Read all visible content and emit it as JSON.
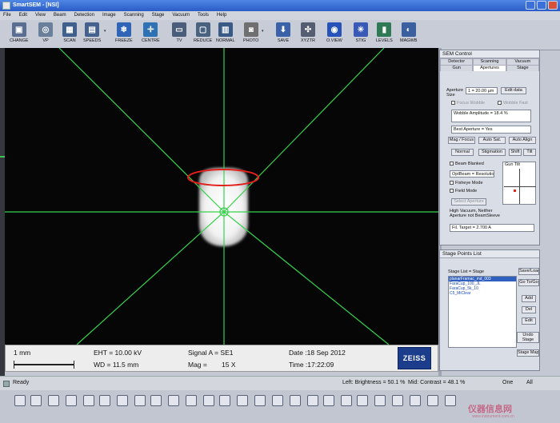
{
  "window": {
    "title": "SmartSEM - [NSI]"
  },
  "menu": [
    "File",
    "Edit",
    "View",
    "Beam",
    "Detection",
    "Image",
    "Scanning",
    "Stage",
    "Vacuum",
    "Tools",
    "Help"
  ],
  "toolbar": [
    {
      "label": "CHANGE",
      "icon": "change-icon",
      "color": "#5a6e92"
    },
    {
      "label": "VP",
      "icon": "vp-icon",
      "color": "#6a7f99"
    },
    {
      "label": "SCAN",
      "icon": "scan-icon",
      "color": "#3f5f8d"
    },
    {
      "label": "SPEEDS",
      "icon": "speeds-icon",
      "color": "#46618e"
    },
    {
      "label": "FREEZE",
      "icon": "freeze-icon",
      "color": "#2f64b6"
    },
    {
      "label": "CENTRE",
      "icon": "centre-icon",
      "color": "#2f72b4"
    },
    {
      "label": "TV",
      "icon": "tv-icon",
      "color": "#4a5e7c"
    },
    {
      "label": "REDUCE",
      "icon": "reduce-icon",
      "color": "#48627f"
    },
    {
      "label": "NORMAL",
      "icon": "normal-icon",
      "color": "#3a5a86"
    },
    {
      "label": "PHOTO",
      "icon": "photo-icon",
      "color": "#6f6f6f"
    },
    {
      "label": "SAVE",
      "icon": "save-icon",
      "color": "#3b62a8"
    },
    {
      "label": "XYZTR",
      "icon": "xyztr-icon",
      "color": "#555d70"
    },
    {
      "label": "O.VIEW",
      "icon": "oview-icon",
      "color": "#2753b8"
    },
    {
      "label": "STIG",
      "icon": "stig-icon",
      "color": "#3959b6"
    },
    {
      "label": "LEVELS",
      "icon": "levels-icon",
      "color": "#2d7a55"
    },
    {
      "label": "MAGWB",
      "icon": "magwb-icon",
      "color": "#3b5f9f"
    }
  ],
  "info": {
    "scale_label": "1 mm",
    "eht": "EHT = 10.00 kV",
    "wd": "WD = 11.5 mm",
    "signal": "Signal A = SE1",
    "mag_label": "Mag =",
    "mag_value": "15 X",
    "date": "Date :18 Sep 2012",
    "time": "Time :17:22:09",
    "logo": "ZEISS"
  },
  "sem": {
    "title": "SEM Control",
    "tabs_top": [
      "Detector",
      "Scanning",
      "Vacuum"
    ],
    "tabs_bottom": [
      "Gun",
      "Apertures",
      "Stage"
    ],
    "aperture_label": "Aperture Size",
    "aperture_value": "1 = 20.00 µm",
    "edit_data": "Edit data",
    "focus_wobble": "Focus Wobble",
    "wobble_fast": "Wobble Fast",
    "wobble_amplitude": "Wobble Amplitude = 18.4 %",
    "best_aperture": "Best Aperture = Yes",
    "mag_focus": "Mag / Focus",
    "auto_sat": "Auto Sat.",
    "auto_align": "Auto Align",
    "normal": "Normal",
    "stigmation": "Stigmation",
    "shift": "Shift",
    "tilt": "Tilt",
    "beam_blanked": "Beam Blanked",
    "optbeam": "OptBeam = Resolution",
    "gun_tilt": "Gun Tilt",
    "fisheye": "Fisheye Mode",
    "field": "Field Mode",
    "select_aperture": "Select Aperture",
    "status": "High Vacuum, Neither Aperture not BeamSleeve",
    "fil_target": "Fil. Target = 2.700 A"
  },
  "stage_points": {
    "title": "Stage Points List",
    "list_label": "Stage List = Stage",
    "items": [
      "planarFramac_md_003",
      "FaraCup_100_JL",
      "FaraCup_5k_10",
      "C5_MiClear"
    ],
    "buttons": [
      "Save/Load",
      "Go To/Go",
      "Add",
      "Del",
      "Edit",
      "Undo Stage Goto",
      "Stage Map"
    ]
  },
  "status": {
    "ready": "Ready",
    "brightness": "Left: Brightness = 50.1 %",
    "mid": "Mid: Contrast = 48.1 %",
    "one": "One",
    "all": "All"
  },
  "watermark": "仪器信息网",
  "watermark_url": "www.instrument.com.cn",
  "colors": {
    "crosshair": "#37d24e",
    "highlight_ellipse": "#e3201b",
    "title_bar": "#2a5bc7"
  }
}
